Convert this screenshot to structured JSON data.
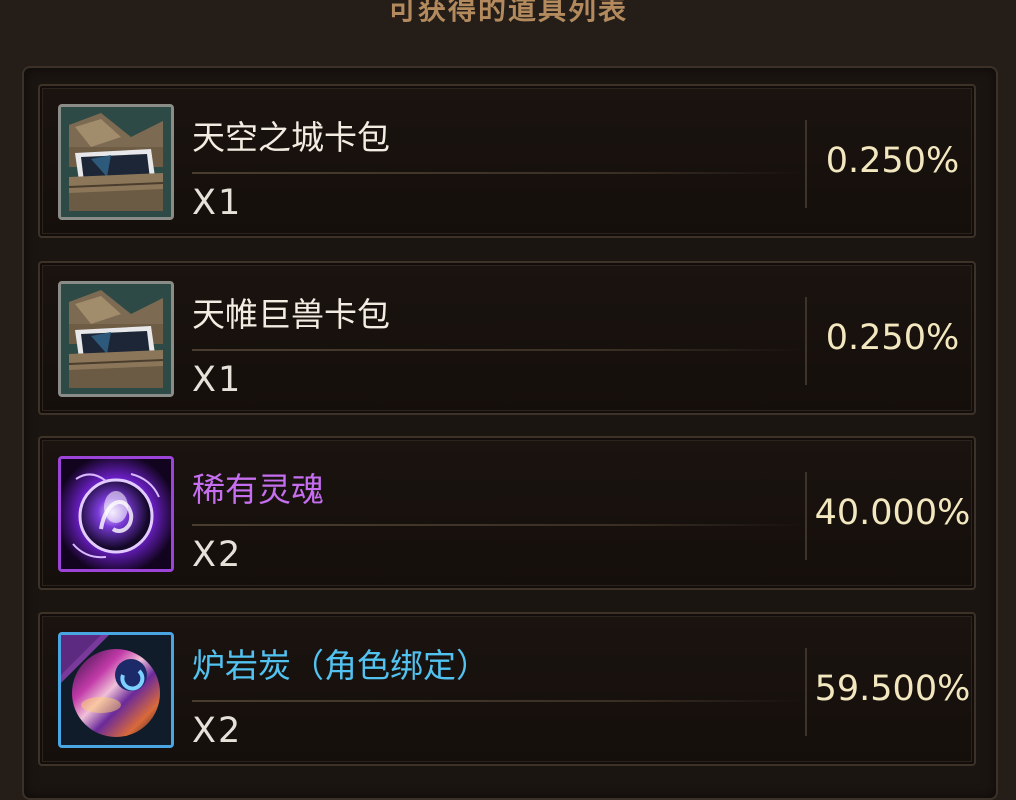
{
  "header": {
    "title": "可获得的道具列表"
  },
  "items": [
    {
      "name": "天空之城卡包",
      "quantity": "X1",
      "rate": "0.250%",
      "icon": "card-pack-icon",
      "rarity_color": "#f2ece2"
    },
    {
      "name": "天帷巨兽卡包",
      "quantity": "X1",
      "rate": "0.250%",
      "icon": "card-pack-icon",
      "rarity_color": "#f2ece2"
    },
    {
      "name": "稀有灵魂",
      "quantity": "X2",
      "rate": "40.000%",
      "icon": "rare-soul-orb-icon",
      "rarity_color": "#c66ef0"
    },
    {
      "name": "炉岩炭（角色绑定）",
      "quantity": "X2",
      "rate": "59.500%",
      "icon": "furnace-coal-orb-icon",
      "badge": "角色",
      "rarity_color": "#52c2f0"
    }
  ],
  "colors": {
    "background": "#241d18",
    "header_text": "#b38a5d",
    "rate_text": "#f3e7c0"
  }
}
